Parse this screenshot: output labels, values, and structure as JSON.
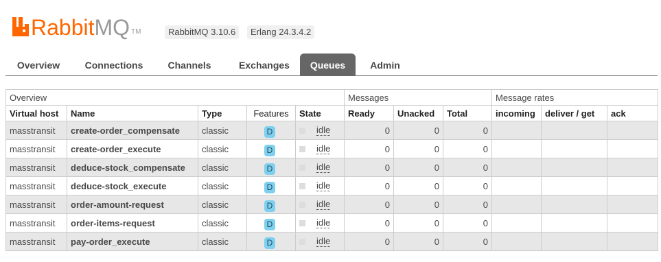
{
  "header": {
    "logo_rabbit": "Rabbit",
    "logo_mq": "MQ",
    "logo_tm": "TM",
    "rabbitmq_version": "RabbitMQ 3.10.6",
    "erlang_version": "Erlang 24.3.4.2"
  },
  "tabs": [
    {
      "label": "Overview",
      "active": false
    },
    {
      "label": "Connections",
      "active": false
    },
    {
      "label": "Channels",
      "active": false
    },
    {
      "label": "Exchanges",
      "active": false
    },
    {
      "label": "Queues",
      "active": true
    },
    {
      "label": "Admin",
      "active": false
    }
  ],
  "table": {
    "groups": {
      "overview": "Overview",
      "messages": "Messages",
      "message_rates": "Message rates"
    },
    "columns": {
      "vhost": "Virtual host",
      "name": "Name",
      "type": "Type",
      "features": "Features",
      "state": "State",
      "ready": "Ready",
      "unacked": "Unacked",
      "total": "Total",
      "incoming": "incoming",
      "deliver_get": "deliver / get",
      "ack": "ack"
    },
    "rows": [
      {
        "vhost": "masstransit",
        "name": "create-order_compensate",
        "type": "classic",
        "feature": "D",
        "state": "idle",
        "ready": "0",
        "unacked": "0",
        "total": "0",
        "incoming": "",
        "deliver_get": "",
        "ack": ""
      },
      {
        "vhost": "masstransit",
        "name": "create-order_execute",
        "type": "classic",
        "feature": "D",
        "state": "idle",
        "ready": "0",
        "unacked": "0",
        "total": "0",
        "incoming": "",
        "deliver_get": "",
        "ack": ""
      },
      {
        "vhost": "masstransit",
        "name": "deduce-stock_compensate",
        "type": "classic",
        "feature": "D",
        "state": "idle",
        "ready": "0",
        "unacked": "0",
        "total": "0",
        "incoming": "",
        "deliver_get": "",
        "ack": ""
      },
      {
        "vhost": "masstransit",
        "name": "deduce-stock_execute",
        "type": "classic",
        "feature": "D",
        "state": "idle",
        "ready": "0",
        "unacked": "0",
        "total": "0",
        "incoming": "",
        "deliver_get": "",
        "ack": ""
      },
      {
        "vhost": "masstransit",
        "name": "order-amount-request",
        "type": "classic",
        "feature": "D",
        "state": "idle",
        "ready": "0",
        "unacked": "0",
        "total": "0",
        "incoming": "",
        "deliver_get": "",
        "ack": ""
      },
      {
        "vhost": "masstransit",
        "name": "order-items-request",
        "type": "classic",
        "feature": "D",
        "state": "idle",
        "ready": "0",
        "unacked": "0",
        "total": "0",
        "incoming": "",
        "deliver_get": "",
        "ack": ""
      },
      {
        "vhost": "masstransit",
        "name": "pay-order_execute",
        "type": "classic",
        "feature": "D",
        "state": "idle",
        "ready": "0",
        "unacked": "0",
        "total": "0",
        "incoming": "",
        "deliver_get": "",
        "ack": ""
      }
    ]
  },
  "colors": {
    "brand_orange": "#ff6600",
    "active_tab_bg": "#666666",
    "feature_badge_bg": "#7fd0ef",
    "odd_row_bg": "#e7e7e7"
  },
  "icons": {
    "logo": "rabbitmq-logo-icon",
    "state": "state-indicator-icon"
  }
}
